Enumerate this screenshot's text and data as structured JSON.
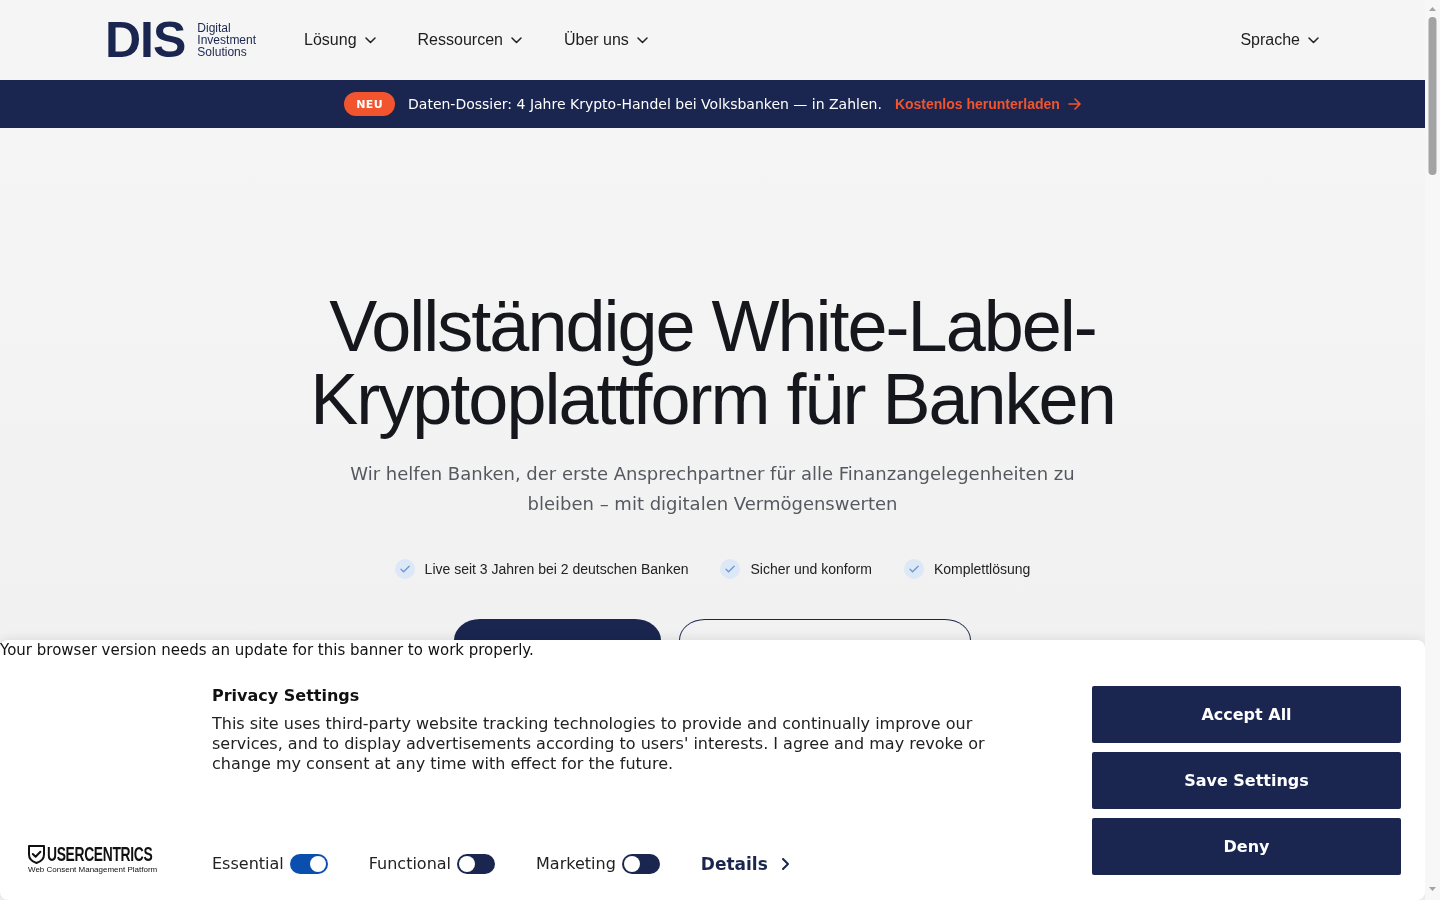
{
  "header": {
    "logo": {
      "mark": "DIS",
      "tagline": "Digital Investment Solutions"
    },
    "nav": [
      {
        "label": "Lösung"
      },
      {
        "label": "Ressourcen"
      },
      {
        "label": "Über uns"
      }
    ],
    "language": {
      "label": "Sprache"
    }
  },
  "announcement": {
    "badge": "NEU",
    "text": "Daten-Dossier: 4 Jahre Krypto-Handel bei Volksbanken — in Zahlen.",
    "link": "Kostenlos herunterladen"
  },
  "hero": {
    "title": "Vollständige White-Label-Kryptoplattform für Banken",
    "subtitle": "Wir helfen Banken, der erste Ansprechpartner für alle Finanzangelegenheiten zu bleiben – mit digitalen Vermögenswerten",
    "features": [
      "Live seit 3 Jahren bei 2 deutschen Banken",
      "Sicher und konform",
      "Komplettlösung"
    ],
    "buttons": [
      {
        "kind": "primary"
      },
      {
        "kind": "outline"
      }
    ]
  },
  "cookie_banner": {
    "notice": "Your browser version needs an update for this banner to work properly.",
    "title": "Privacy Settings",
    "text": "This site uses third-party website tracking technologies to provide and continually improve our services, and to display advertisements according to users' interests. I agree and may revoke or change my consent at any time with effect for the future.",
    "branding": {
      "name": "USERCENTRICS",
      "tagline": "Web Consent Management Platform"
    },
    "toggles": [
      {
        "label": "Essential",
        "on": true
      },
      {
        "label": "Functional",
        "on": false
      },
      {
        "label": "Marketing",
        "on": false
      }
    ],
    "details": "Details",
    "buttons": [
      "Accept All",
      "Save Settings",
      "Deny"
    ]
  }
}
